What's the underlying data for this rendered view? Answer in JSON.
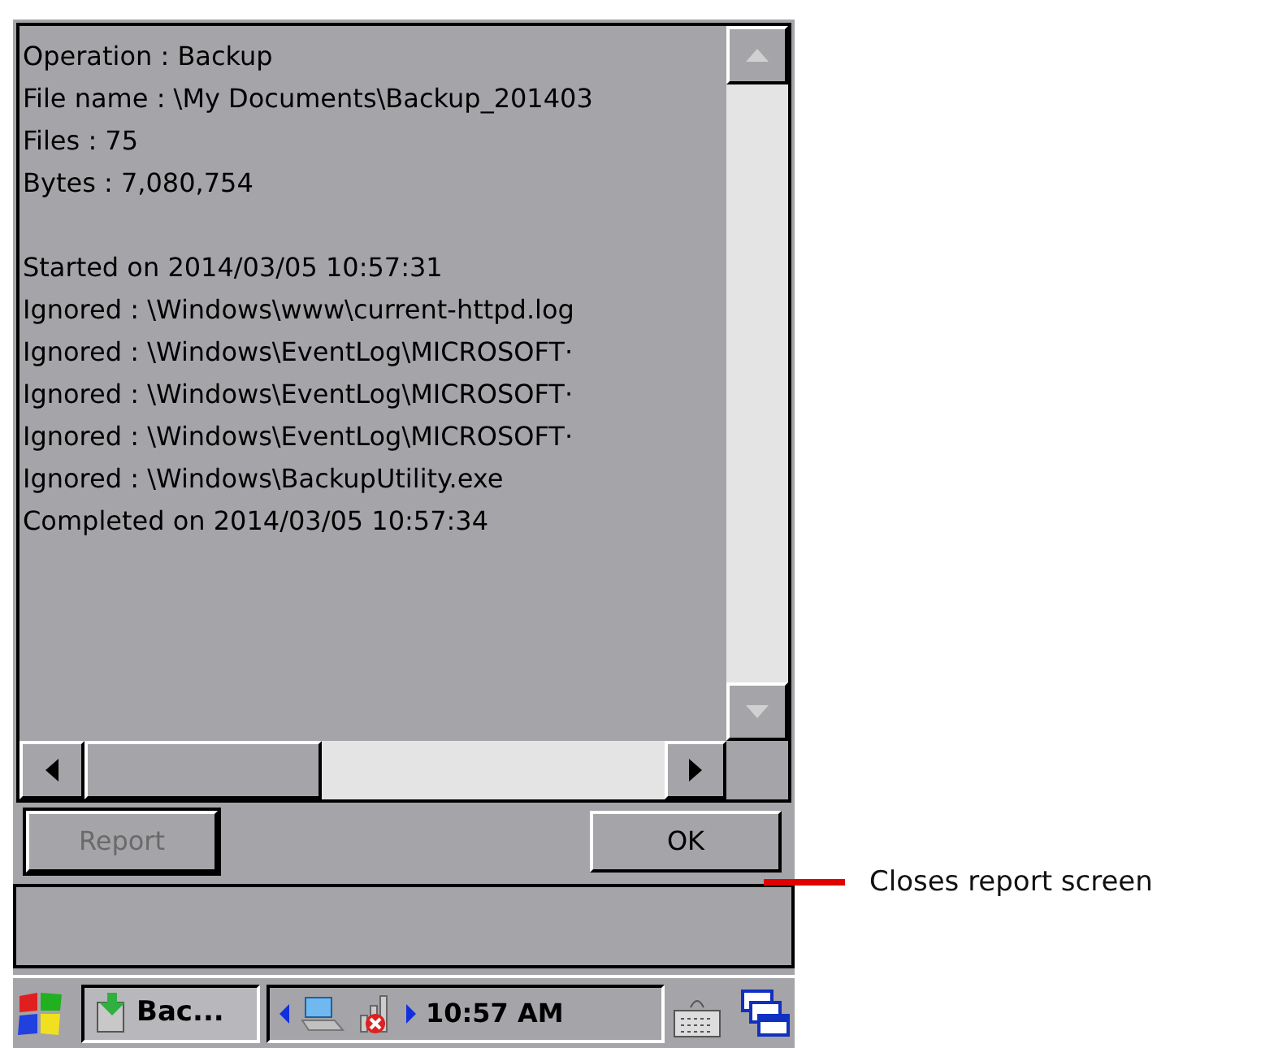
{
  "report": {
    "paragraphs": [
      [
        "Operation : Backup",
        "File name : \\My Documents\\Backup_201403",
        "Files : 75",
        "Bytes : 7,080,754"
      ],
      [
        "Started on 2014/03/05 10:57:31",
        "Ignored : \\Windows\\www\\current-httpd.log",
        "Ignored : \\Windows\\EventLog\\MICROSOFT·",
        "Ignored : \\Windows\\EventLog\\MICROSOFT·",
        "Ignored : \\Windows\\EventLog\\MICROSOFT·",
        "Ignored : \\Windows\\BackupUtility.exe",
        "Completed on 2014/03/05 10:57:34"
      ]
    ]
  },
  "buttons": [
    {
      "label": "Report",
      "disabled": true
    },
    {
      "label": "OK",
      "disabled": false
    }
  ],
  "taskbar": {
    "task": "Bac...",
    "clock": "10:57 AM"
  },
  "annotation": "Closes report screen"
}
